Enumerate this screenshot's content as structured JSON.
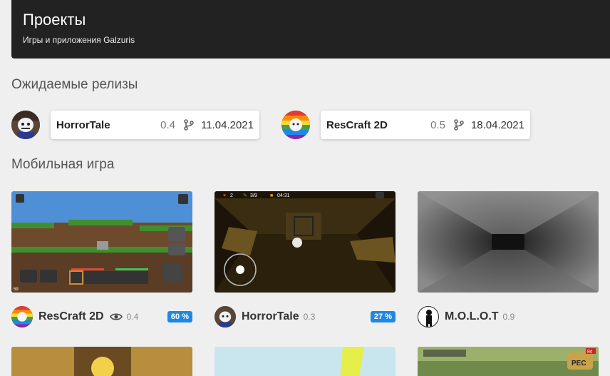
{
  "header": {
    "title": "Проекты",
    "subtitle": "Игры и приложения Galzuris"
  },
  "sections": {
    "releases": "Ожидаемые релизы",
    "mobile": "Мобильная игра"
  },
  "releases": [
    {
      "name": "HorrorTale",
      "version": "0.4",
      "date": "11.04.2021",
      "avatar": "horrortale-avatar"
    },
    {
      "name": "ResCraft 2D",
      "version": "0.5",
      "date": "18.04.2021",
      "avatar": "rescraft-avatar"
    }
  ],
  "games": [
    {
      "name": "ResCraft 2D",
      "version": "0.4",
      "progress": "60 %",
      "has_eye": true,
      "hud_counter": "59"
    },
    {
      "name": "HorrorTale",
      "version": "0.3",
      "progress": "27 %",
      "hud": {
        "hearts": "2",
        "keys": "3/9",
        "time": "04:31"
      }
    },
    {
      "name": "M.O.L.O.T",
      "version": "0.9"
    }
  ],
  "bottom_row": {
    "third_hud_label": "PEC",
    "third_hud_badge": "Bd"
  },
  "colors": {
    "accent": "#1e88e5",
    "header_bg": "#222222",
    "page_bg": "#efefef"
  }
}
